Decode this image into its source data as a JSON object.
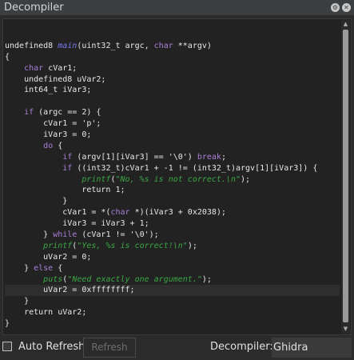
{
  "window": {
    "title": "Decompiler"
  },
  "code_lines": [
    [],
    [
      {
        "t": "undefined8 "
      },
      {
        "t": "main",
        "c": "fn"
      },
      {
        "t": "(uint32_t argc, "
      },
      {
        "t": "char",
        "c": "kw"
      },
      {
        "t": " **argv)"
      }
    ],
    [
      {
        "t": "{"
      }
    ],
    [
      {
        "t": "    "
      },
      {
        "t": "char",
        "c": "kw"
      },
      {
        "t": " cVar1;"
      }
    ],
    [
      {
        "t": "    undefined8 uVar2;"
      }
    ],
    [
      {
        "t": "    int64_t iVar3;"
      }
    ],
    [],
    [
      {
        "t": "    "
      },
      {
        "t": "if",
        "c": "kw"
      },
      {
        "t": " (argc == 2) {"
      }
    ],
    [
      {
        "t": "        cVar1 = 'p';"
      }
    ],
    [
      {
        "t": "        iVar3 = 0;"
      }
    ],
    [
      {
        "t": "        "
      },
      {
        "t": "do",
        "c": "kw"
      },
      {
        "t": " {"
      }
    ],
    [
      {
        "t": "            "
      },
      {
        "t": "if",
        "c": "kw"
      },
      {
        "t": " (argv[1][iVar3] == '\\0') "
      },
      {
        "t": "break",
        "c": "kw"
      },
      {
        "t": ";"
      }
    ],
    [
      {
        "t": "            "
      },
      {
        "t": "if",
        "c": "kw"
      },
      {
        "t": " ((int32_t)cVar1 + -1 != (int32_t)argv[1][iVar3]) {"
      }
    ],
    [
      {
        "t": "                "
      },
      {
        "t": "printf",
        "c": "call"
      },
      {
        "t": "("
      },
      {
        "t": "\"No, %s is not correct.\\n\"",
        "c": "str"
      },
      {
        "t": ");"
      }
    ],
    [
      {
        "t": "                return 1;"
      }
    ],
    [
      {
        "t": "            }"
      }
    ],
    [
      {
        "t": "            cVar1 = *("
      },
      {
        "t": "char",
        "c": "kw"
      },
      {
        "t": " *)(iVar3 + 0x2038);"
      }
    ],
    [
      {
        "t": "            iVar3 = iVar3 + 1;"
      }
    ],
    [
      {
        "t": "        } "
      },
      {
        "t": "while",
        "c": "kw"
      },
      {
        "t": " (cVar1 != '\\0');"
      }
    ],
    [
      {
        "t": "        "
      },
      {
        "t": "printf",
        "c": "call"
      },
      {
        "t": "("
      },
      {
        "t": "\"Yes, %s is correct!\\n\"",
        "c": "str"
      },
      {
        "t": ");"
      }
    ],
    [
      {
        "t": "        uVar2 = 0;"
      }
    ],
    [
      {
        "t": "    } "
      },
      {
        "t": "else",
        "c": "kw"
      },
      {
        "t": " {"
      }
    ],
    [
      {
        "t": "        "
      },
      {
        "t": "puts",
        "c": "call"
      },
      {
        "t": "("
      },
      {
        "t": "\"Need exactly one argument.\"",
        "c": "str"
      },
      {
        "t": ");"
      }
    ],
    [
      {
        "t": "        uVar2 = 0xffffffff;"
      }
    ],
    [
      {
        "t": "    }"
      }
    ],
    [
      {
        "t": "    return uVar2;"
      }
    ],
    [
      {
        "t": "}"
      }
    ]
  ],
  "highlighted_line": 23,
  "colors": {
    "keyword": "#a97fd8",
    "function_name": "#7a7af0",
    "string_and_call": "#3aa845",
    "background": "#222222"
  },
  "bottom": {
    "auto_refresh_label": "Auto Refresh",
    "auto_refresh_checked": false,
    "refresh_label": "Refresh",
    "decompiler_label": "Decompiler:",
    "decompiler_value": "Ghidra"
  }
}
